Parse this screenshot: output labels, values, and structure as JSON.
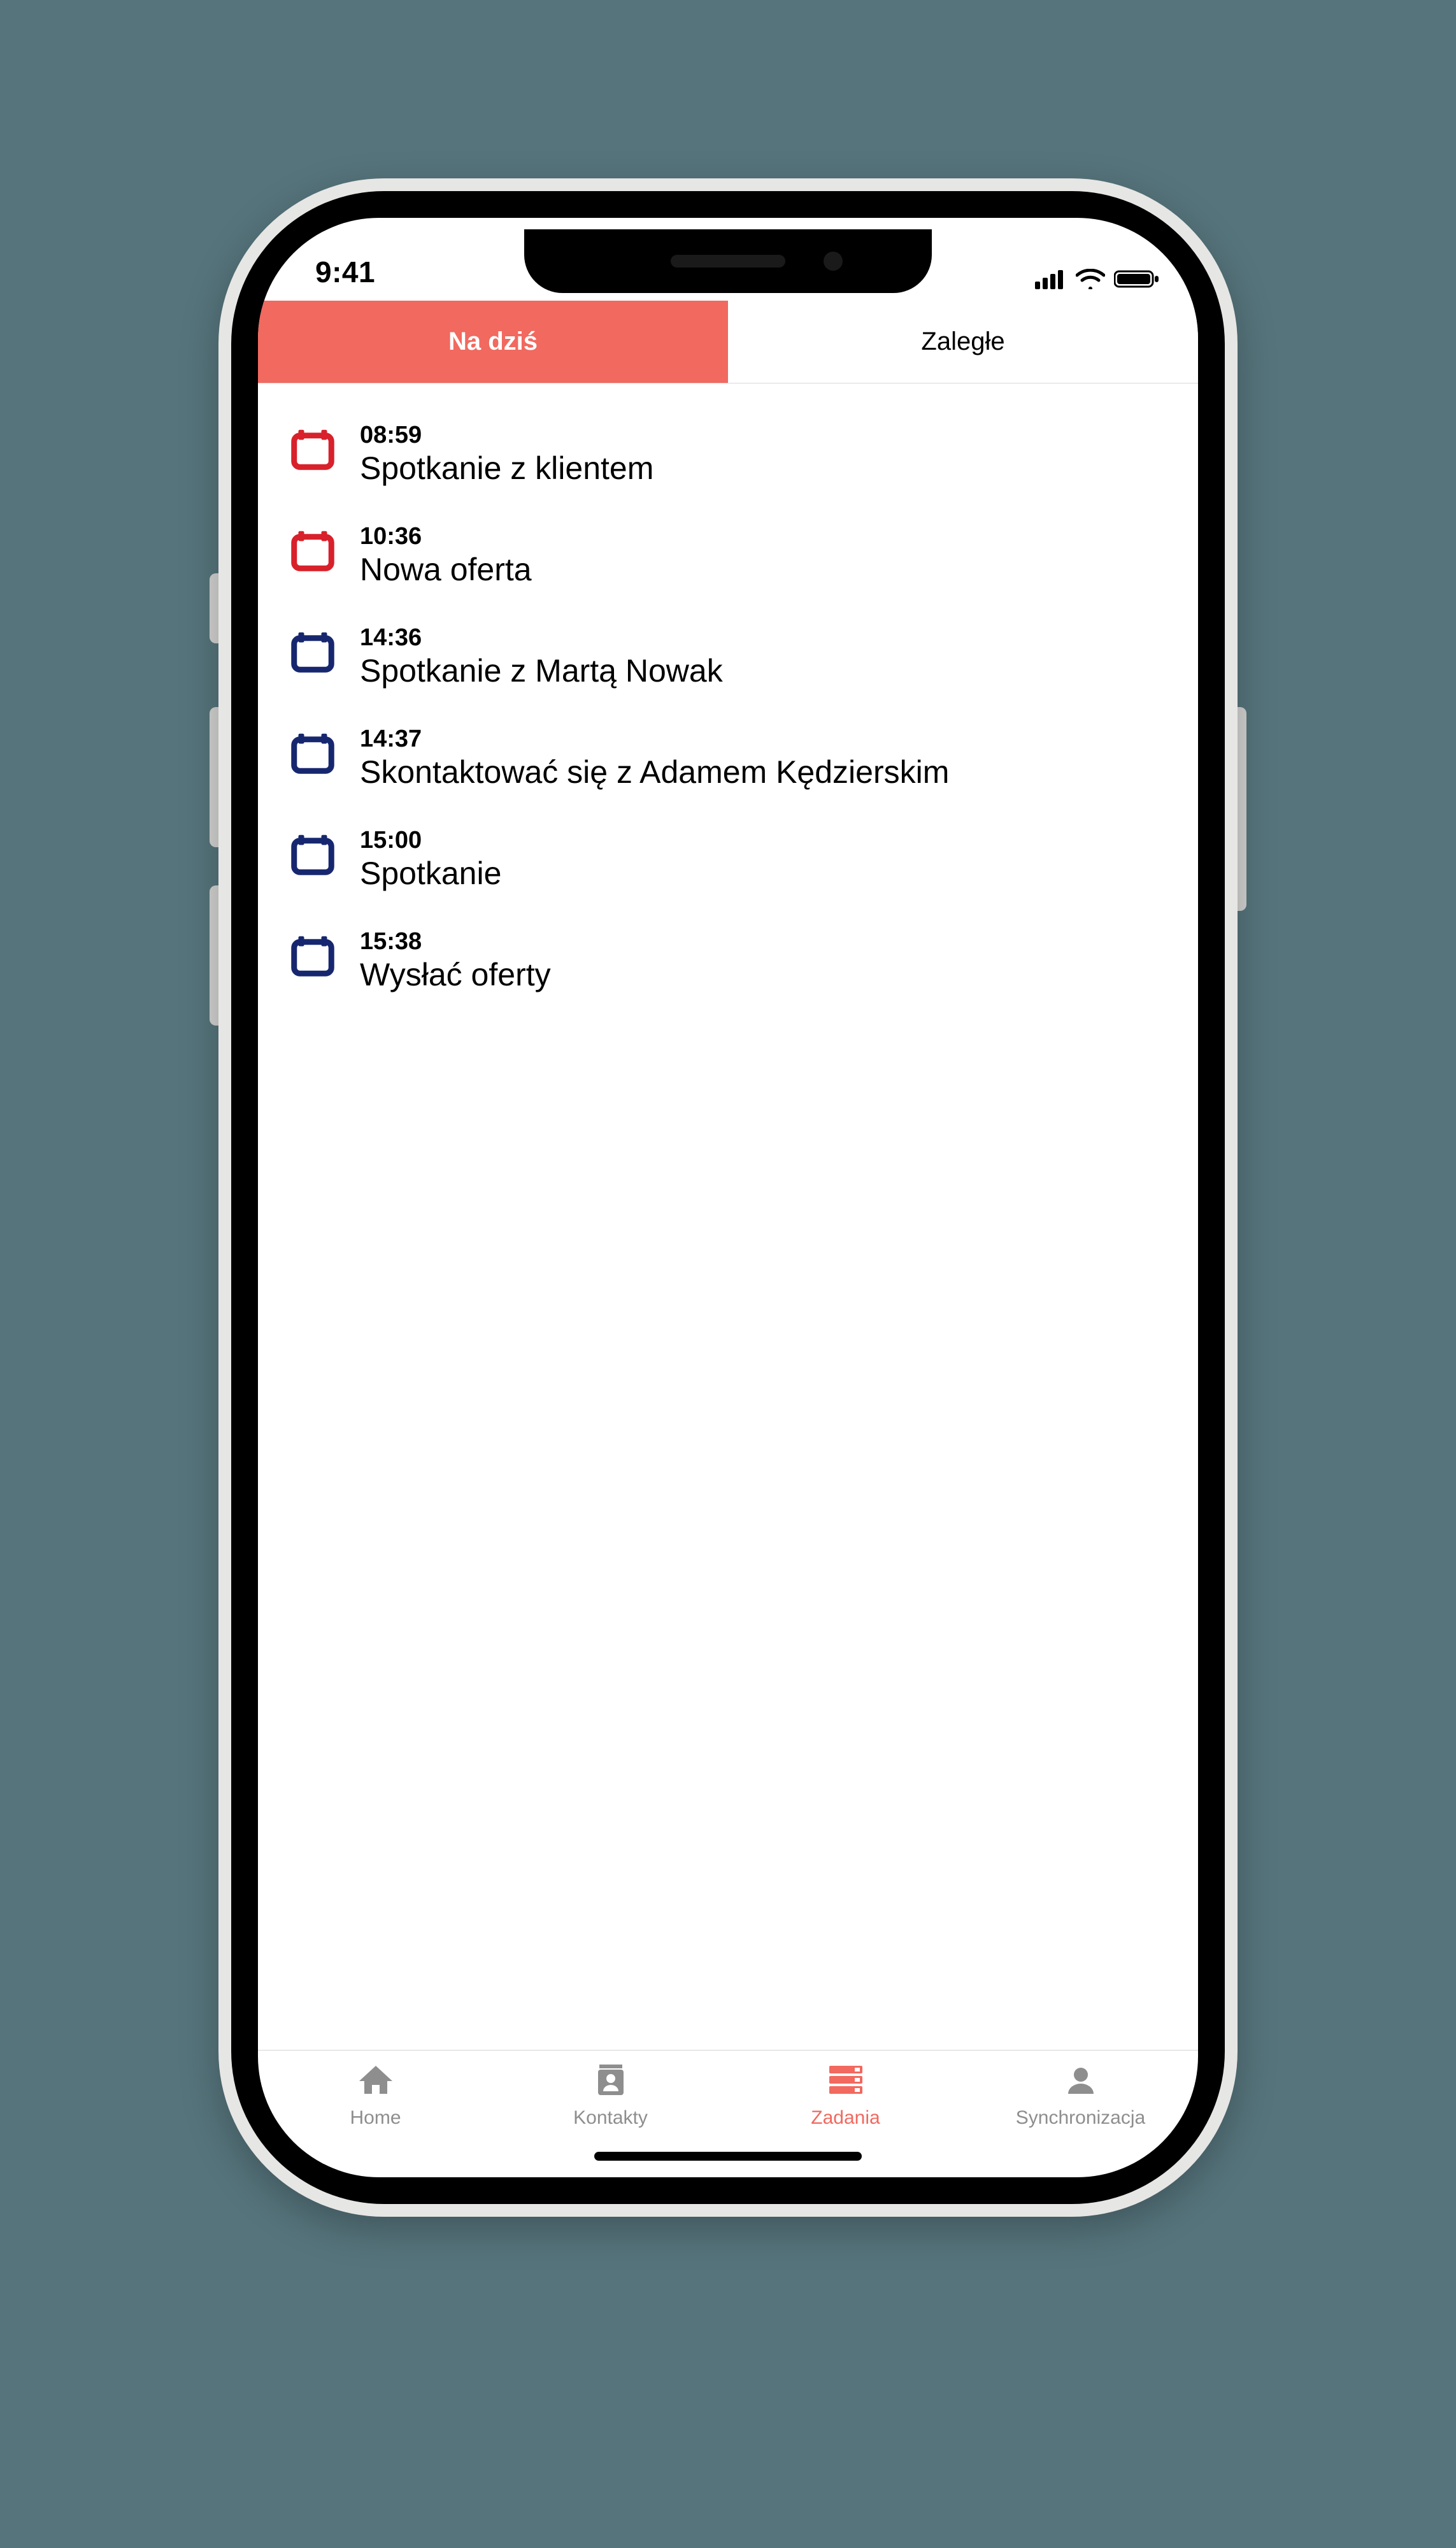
{
  "status": {
    "time": "9:41"
  },
  "seg": {
    "today": {
      "label": "Na dziś",
      "active": true
    },
    "overdue": {
      "label": "Zaległe",
      "active": false
    }
  },
  "colors": {
    "red": "#d8212b",
    "blue": "#17276f",
    "accent": "#f1695f"
  },
  "tasks": [
    {
      "time": "08:59",
      "title": "Spotkanie z klientem",
      "color": "red"
    },
    {
      "time": "10:36",
      "title": "Nowa oferta",
      "color": "red"
    },
    {
      "time": "14:36",
      "title": "Spotkanie z Martą Nowak",
      "color": "blue"
    },
    {
      "time": "14:37",
      "title": "Skontaktować się z Adamem Kędzierskim",
      "color": "blue"
    },
    {
      "time": "15:00",
      "title": "Spotkanie",
      "color": "blue"
    },
    {
      "time": "15:38",
      "title": "Wysłać oferty",
      "color": "blue"
    }
  ],
  "tabs": {
    "home": {
      "label": "Home"
    },
    "contacts": {
      "label": "Kontakty"
    },
    "tasks": {
      "label": "Zadania"
    },
    "sync": {
      "label": "Synchronizacja"
    }
  }
}
